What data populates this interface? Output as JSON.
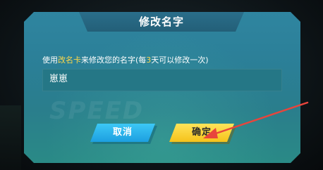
{
  "dialog": {
    "title": "修改名字",
    "prompt": {
      "before": "使用",
      "item": "改名卡",
      "middle": "来修改您的名字(每",
      "days": "3",
      "after": "天可以修改一次)"
    },
    "name_value": "崽崽",
    "background_text": "SPEED"
  },
  "buttons": {
    "cancel_label": "取消",
    "confirm_label": "确定"
  },
  "colors": {
    "highlight": "#ffd84a",
    "cancel": "#29b4ee",
    "confirm": "#fad43a",
    "arrow": "#e8453c"
  }
}
